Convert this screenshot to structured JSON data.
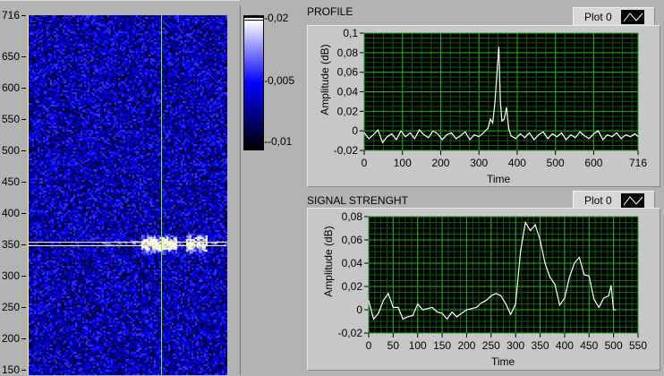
{
  "intensity_graph": {
    "y_ticks": [
      "716",
      "650",
      "600",
      "550",
      "500",
      "450",
      "400",
      "350",
      "300",
      "250",
      "200",
      "150"
    ],
    "y_range": [
      0,
      716
    ],
    "cursor": {
      "x_fraction": 0.67,
      "y_value": 352
    },
    "colorbar": {
      "ticks": [
        "0,02",
        "0,005",
        "-0,01"
      ],
      "colors": [
        "#ffffff",
        "#0000ff",
        "#000000"
      ]
    }
  },
  "chart_data": [
    {
      "type": "line",
      "title": "PROFILE",
      "xlabel": "Time",
      "ylabel": "Amplitude (dB)",
      "legend": "Plot 0",
      "xlim": [
        0,
        716
      ],
      "ylim": [
        -0.02,
        0.1
      ],
      "x_ticks": [
        "0",
        "100",
        "200",
        "300",
        "400",
        "500",
        "600",
        "716"
      ],
      "y_ticks": [
        "0,1",
        "0,08",
        "0,06",
        "0,04",
        "0,02",
        "0",
        "-0,02"
      ],
      "x": [
        0,
        12,
        24,
        36,
        48,
        60,
        72,
        84,
        96,
        108,
        120,
        132,
        144,
        156,
        168,
        180,
        192,
        204,
        216,
        228,
        240,
        252,
        264,
        276,
        288,
        300,
        312,
        324,
        330,
        336,
        342,
        348,
        352,
        356,
        360,
        366,
        372,
        378,
        384,
        396,
        408,
        420,
        432,
        444,
        456,
        468,
        480,
        492,
        504,
        516,
        528,
        540,
        552,
        564,
        576,
        588,
        600,
        612,
        624,
        636,
        648,
        660,
        672,
        684,
        696,
        708,
        716
      ],
      "values": [
        -0.002,
        -0.008,
        -0.004,
        0.001,
        -0.012,
        -0.006,
        -0.003,
        -0.009,
        0.0,
        -0.006,
        -0.002,
        -0.008,
        0.001,
        -0.004,
        -0.007,
        0.0,
        -0.003,
        -0.009,
        -0.004,
        -0.002,
        -0.008,
        -0.005,
        -0.001,
        -0.009,
        -0.004,
        -0.006,
        -0.002,
        0.003,
        0.012,
        0.008,
        0.03,
        0.065,
        0.086,
        0.03,
        0.01,
        0.012,
        0.024,
        0.002,
        -0.005,
        -0.008,
        -0.003,
        -0.007,
        -0.002,
        -0.009,
        -0.004,
        -0.001,
        -0.008,
        -0.003,
        -0.006,
        -0.002,
        -0.009,
        -0.004,
        -0.007,
        -0.001,
        -0.005,
        -0.008,
        -0.003,
        0.0,
        -0.009,
        -0.004,
        -0.006,
        -0.002,
        -0.008,
        -0.004,
        -0.006,
        -0.003,
        -0.006
      ]
    },
    {
      "type": "line",
      "title": "SIGNAL STRENGHT",
      "xlabel": "Time",
      "ylabel": "Amplitude (dB)",
      "legend": "Plot 0",
      "xlim": [
        0,
        550
      ],
      "ylim": [
        -0.02,
        0.08
      ],
      "x_ticks": [
        "0",
        "50",
        "100",
        "150",
        "200",
        "250",
        "300",
        "350",
        "400",
        "450",
        "500",
        "550"
      ],
      "y_ticks": [
        "0,08",
        "0,06",
        "0,04",
        "0,02",
        "0",
        "-0,02"
      ],
      "x": [
        0,
        10,
        20,
        30,
        40,
        50,
        60,
        70,
        80,
        90,
        100,
        110,
        120,
        130,
        140,
        150,
        160,
        170,
        180,
        190,
        200,
        210,
        220,
        230,
        240,
        250,
        260,
        270,
        280,
        290,
        300,
        310,
        320,
        330,
        340,
        350,
        360,
        370,
        380,
        390,
        400,
        410,
        420,
        430,
        440,
        450,
        460,
        470,
        480,
        490,
        495,
        500,
        505
      ],
      "values": [
        0.008,
        -0.008,
        -0.003,
        0.008,
        0.014,
        0.002,
        0.002,
        -0.008,
        -0.006,
        -0.005,
        0.005,
        0.0,
        0.001,
        0.002,
        -0.002,
        -0.003,
        -0.008,
        -0.002,
        -0.006,
        -0.003,
        0.0,
        0.001,
        0.002,
        0.006,
        0.008,
        0.012,
        0.014,
        0.012,
        0.005,
        -0.004,
        0.005,
        0.05,
        0.075,
        0.068,
        0.073,
        0.06,
        0.04,
        0.028,
        0.022,
        0.004,
        0.01,
        0.028,
        0.04,
        0.045,
        0.03,
        0.029,
        0.009,
        0.002,
        0.01,
        0.012,
        0.021,
        0.0,
        0.0
      ]
    }
  ]
}
